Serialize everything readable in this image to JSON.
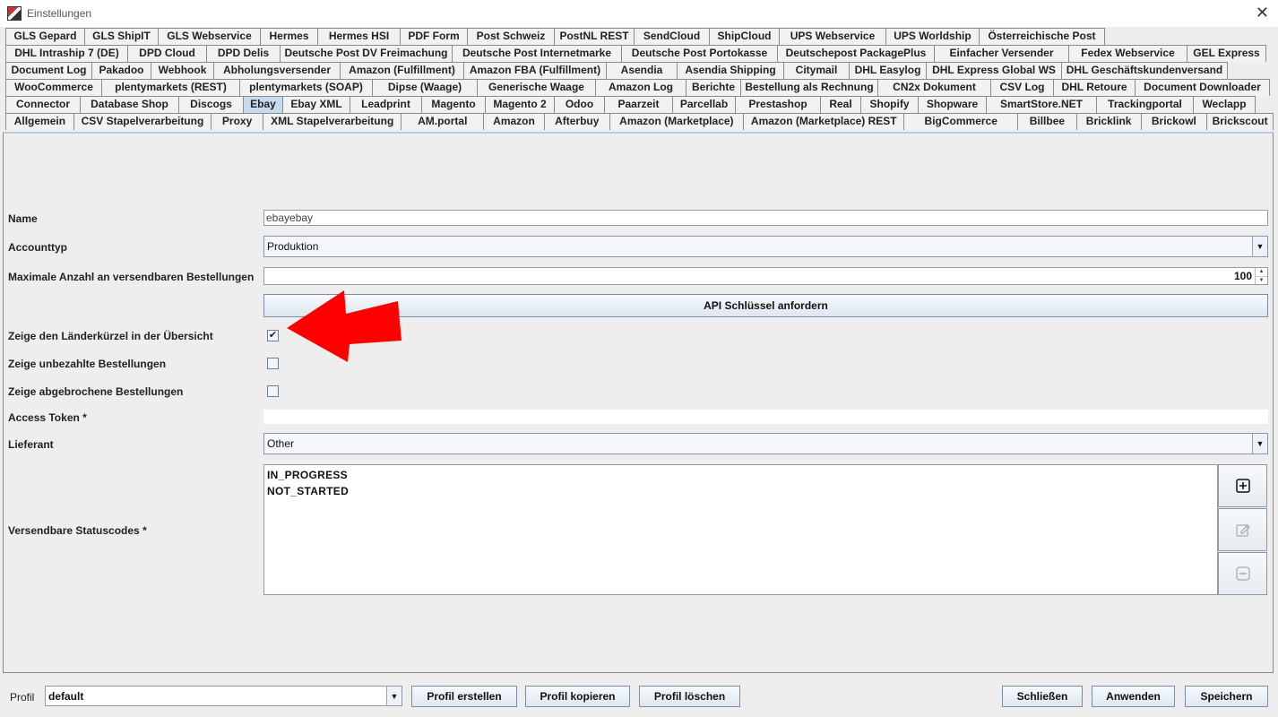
{
  "window": {
    "title": "Einstellungen"
  },
  "tabs": [
    [
      "GLS Gepard",
      "GLS ShipIT",
      "GLS Webservice",
      "Hermes",
      "Hermes HSI",
      "PDF Form",
      "Post Schweiz",
      "PostNL REST",
      "SendCloud",
      "ShipCloud",
      "UPS Webservice",
      "UPS Worldship",
      "Österreichische Post"
    ],
    [
      "DHL Intraship 7 (DE)",
      "DPD Cloud",
      "DPD Delis",
      "Deutsche Post DV Freimachung",
      "Deutsche Post Internetmarke",
      "Deutsche Post Portokasse",
      "Deutschepost PackagePlus",
      "Einfacher Versender",
      "Fedex Webservice",
      "GEL Express"
    ],
    [
      "Document Log",
      "Pakadoo",
      "Webhook",
      "Abholungsversender",
      "Amazon (Fulfillment)",
      "Amazon FBA (Fulfillment)",
      "Asendia",
      "Asendia Shipping",
      "Citymail",
      "DHL Easylog",
      "DHL Express Global WS",
      "DHL Geschäftskundenversand"
    ],
    [
      "WooCommerce",
      "plentymarkets (REST)",
      "plentymarkets (SOAP)",
      "Dipse (Waage)",
      "Generische Waage",
      "Amazon Log",
      "Berichte",
      "Bestellung als Rechnung",
      "CN2x Dokument",
      "CSV Log",
      "DHL Retoure",
      "Document Downloader"
    ],
    [
      "Connector",
      "Database Shop",
      "Discogs",
      "Ebay",
      "Ebay XML",
      "Leadprint",
      "Magento",
      "Magento 2",
      "Odoo",
      "Paarzeit",
      "Parcellab",
      "Prestashop",
      "Real",
      "Shopify",
      "Shopware",
      "SmartStore.NET",
      "Trackingportal",
      "Weclapp"
    ],
    [
      "Allgemein",
      "CSV Stapelverarbeitung",
      "Proxy",
      "XML Stapelverarbeitung",
      "AM.portal",
      "Amazon",
      "Afterbuy",
      "Amazon (Marketplace)",
      "Amazon (Marketplace) REST",
      "BigCommerce",
      "Billbee",
      "Bricklink",
      "Brickowl",
      "Brickscout"
    ]
  ],
  "active_tab": "Ebay",
  "form": {
    "name_label": "Name",
    "name_value": "ebayebay",
    "accounttyp_label": "Accounttyp",
    "accounttyp_value": "Produktion",
    "max_label": "Maximale Anzahl an versendbaren Bestellungen",
    "max_value": "100",
    "api_button": "API Schlüssel anfordern",
    "cb1_label": "Zeige den Länderkürzel in der Übersicht",
    "cb1_checked": true,
    "cb2_label": "Zeige unbezahlte Bestellungen",
    "cb2_checked": false,
    "cb3_label": "Zeige abgebrochene Bestellungen",
    "cb3_checked": false,
    "token_label": "Access Token *",
    "token_value": "",
    "lieferant_label": "Lieferant",
    "lieferant_value": "Other",
    "status_label": "Versendbare Statuscodes *",
    "status_items": [
      "IN_PROGRESS",
      "NOT_STARTED"
    ]
  },
  "footer": {
    "profil_label": "Profil",
    "profil_value": "default",
    "create": "Profil erstellen",
    "copy": "Profil kopieren",
    "delete": "Profil löschen",
    "close": "Schließen",
    "apply": "Anwenden",
    "save": "Speichern"
  },
  "colors": {
    "active_tab": "#c7dbef",
    "arrow": "#ff0000"
  },
  "icons": {
    "add": "plus-box-icon",
    "edit": "edit-pencil-icon",
    "remove": "minus-box-icon"
  }
}
